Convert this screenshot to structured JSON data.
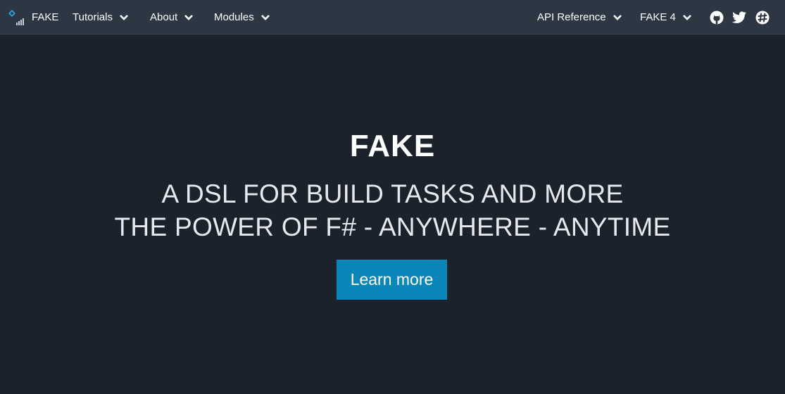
{
  "nav": {
    "brand": "FAKE",
    "left_items": [
      {
        "label": "Tutorials"
      },
      {
        "label": "About"
      },
      {
        "label": "Modules"
      }
    ],
    "right_items": [
      {
        "label": "API Reference"
      },
      {
        "label": "FAKE 4"
      }
    ],
    "social_icons": [
      "github-icon",
      "twitter-icon",
      "slack-icon"
    ]
  },
  "hero": {
    "title": "FAKE",
    "line1": "A DSL FOR BUILD TASKS AND MORE",
    "line2": "THE POWER OF F# - ANYWHERE - ANYTIME",
    "cta_label": "Learn more"
  },
  "colors": {
    "navbar_bg": "#2d3744",
    "page_bg": "#1b222c",
    "accent": "#0a87b8",
    "logo_blue": "#29a3e0"
  }
}
